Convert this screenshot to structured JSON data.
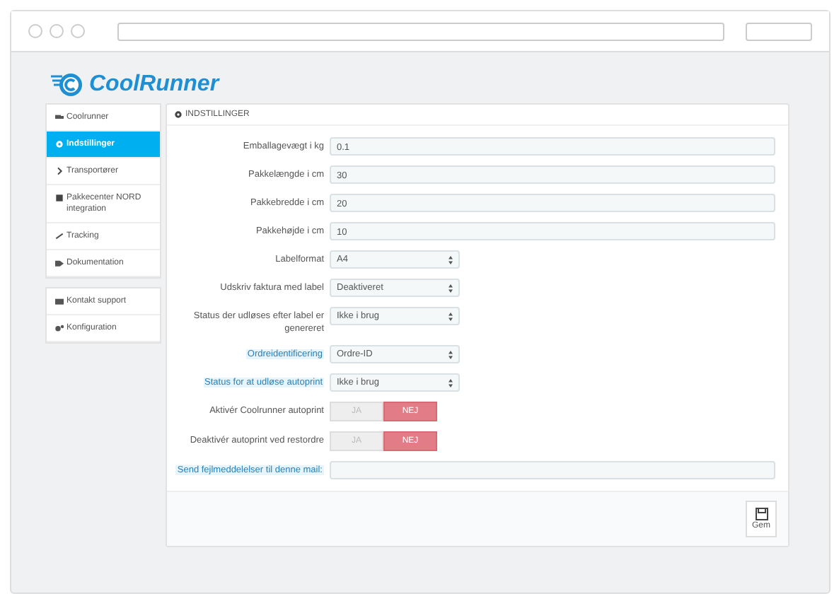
{
  "logo": {
    "text": "CoolRunner"
  },
  "sidebar": {
    "groups": [
      [
        {
          "label": "Coolrunner",
          "selected": false
        },
        {
          "label": "Indstillinger",
          "selected": true
        },
        {
          "label": "Transportører",
          "selected": false
        },
        {
          "label": "Pakkecenter NORD integration",
          "selected": false
        },
        {
          "label": "Tracking",
          "selected": false
        },
        {
          "label": "Dokumentation",
          "selected": false
        }
      ],
      [
        {
          "label": "Kontakt support",
          "selected": false
        },
        {
          "label": "Konfiguration",
          "selected": false
        }
      ]
    ]
  },
  "panel": {
    "title": "INDSTILLINGER",
    "fields": [
      {
        "kind": "text",
        "label": "Emballagevægt i kg",
        "value": "0.1",
        "hint": false
      },
      {
        "kind": "text",
        "label": "Pakkelængde i cm",
        "value": "30",
        "hint": false
      },
      {
        "kind": "text",
        "label": "Pakkebredde i cm",
        "value": "20",
        "hint": false
      },
      {
        "kind": "text",
        "label": "Pakkehøjde i cm",
        "value": "10",
        "hint": false
      },
      {
        "kind": "select",
        "label": "Labelformat",
        "value": "A4",
        "hint": false
      },
      {
        "kind": "select",
        "label": "Udskriv faktura med label",
        "value": "Deaktiveret",
        "hint": false
      },
      {
        "kind": "select",
        "label": "Status der udløses efter label er genereret",
        "value": "Ikke i brug",
        "hint": false
      },
      {
        "kind": "select",
        "label": "Ordreidentificering",
        "value": "Ordre-ID",
        "hint": true
      },
      {
        "kind": "select",
        "label": "Status for at udløse autoprint",
        "value": "Ikke i brug",
        "hint": true
      },
      {
        "kind": "toggle",
        "label": "Aktivér Coolrunner autoprint",
        "options": [
          {
            "label": "JA",
            "selected": false
          },
          {
            "label": "NEJ",
            "selected": true
          }
        ],
        "hint": false
      },
      {
        "kind": "toggle",
        "label": "Deaktivér autoprint ved restordre",
        "options": [
          {
            "label": "JA",
            "selected": false
          },
          {
            "label": "NEJ",
            "selected": true
          }
        ],
        "hint": false
      },
      {
        "kind": "text",
        "label": "Send fejlmeddelelser til denne mail:",
        "hint": true
      }
    ],
    "save_button": "Gem"
  }
}
